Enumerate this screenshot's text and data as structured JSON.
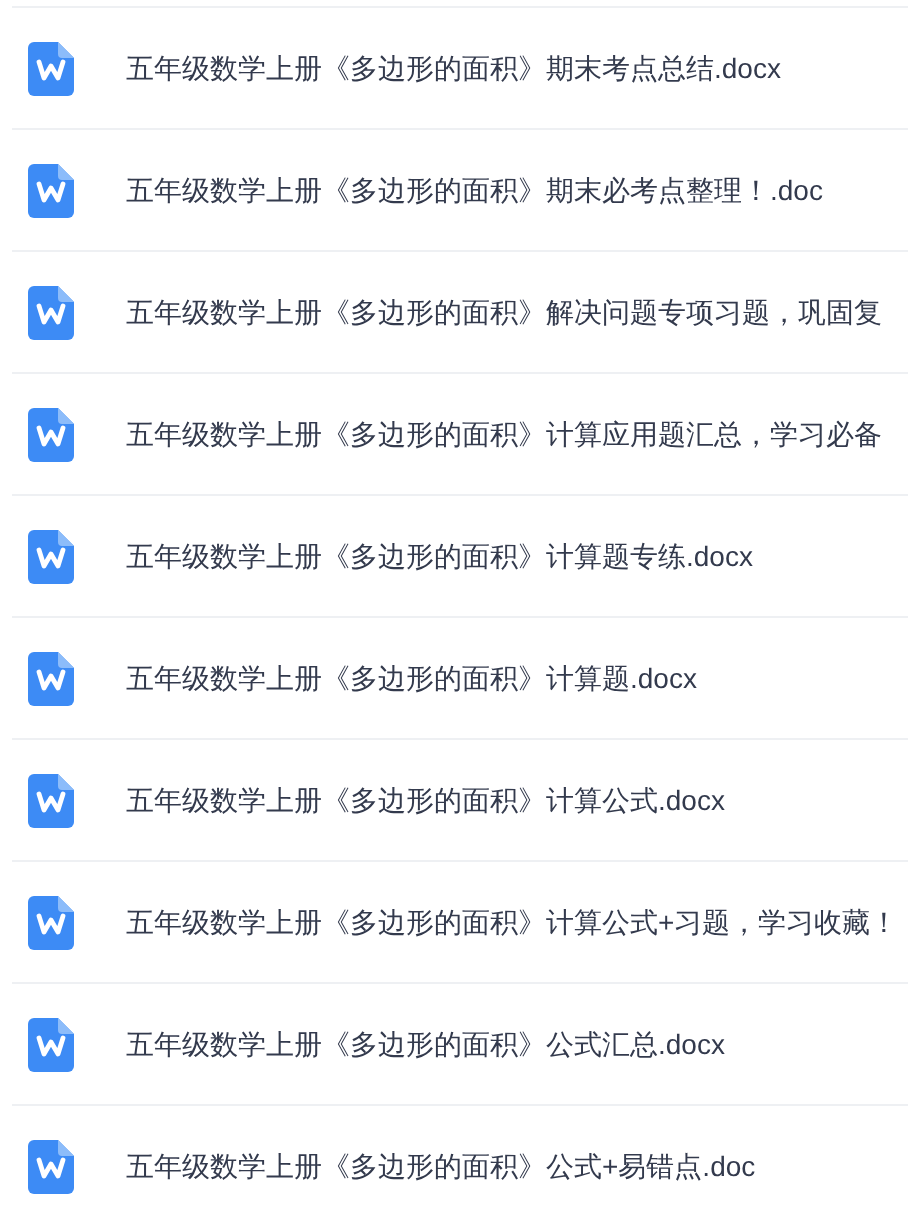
{
  "files": [
    {
      "name": "五年级数学上册《多边形的面积》期末考点总结.docx"
    },
    {
      "name": "五年级数学上册《多边形的面积》期末必考点整理！.doc"
    },
    {
      "name": "五年级数学上册《多边形的面积》解决问题专项习题，巩固复"
    },
    {
      "name": "五年级数学上册《多边形的面积》计算应用题汇总，学习必备"
    },
    {
      "name": "五年级数学上册《多边形的面积》计算题专练.docx"
    },
    {
      "name": "五年级数学上册《多边形的面积》计算题.docx"
    },
    {
      "name": "五年级数学上册《多边形的面积》计算公式.docx"
    },
    {
      "name": "五年级数学上册《多边形的面积》计算公式+习题，学习收藏！"
    },
    {
      "name": "五年级数学上册《多边形的面积》公式汇总.docx"
    },
    {
      "name": "五年级数学上册《多边形的面积》公式+易错点.doc"
    }
  ]
}
